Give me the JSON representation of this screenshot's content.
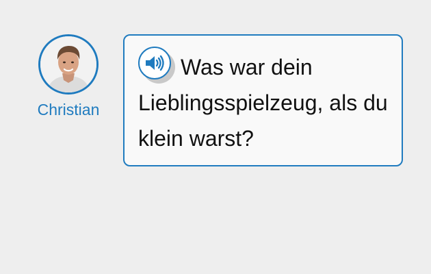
{
  "speaker": {
    "name": "Christian",
    "avatar_icon": "person-photo"
  },
  "message": {
    "text": "Was war dein Lieblingsspielzeug, als du klein warst?",
    "audio_icon": "speaker-icon"
  },
  "colors": {
    "accent": "#1f7bbf",
    "background": "#eeeeee",
    "bubble_background": "#f9f9f9",
    "text": "#111111"
  }
}
